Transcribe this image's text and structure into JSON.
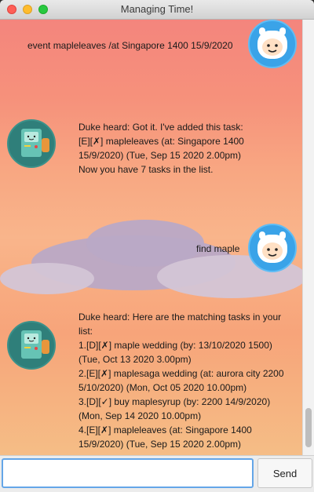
{
  "window": {
    "title": "Managing Time!"
  },
  "messages": [
    {
      "speaker": "user",
      "text": "event mapleleaves /at Singapore 1400 15/9/2020"
    },
    {
      "speaker": "bot",
      "text": "Duke heard: Got it. I've added this task:\n[E][✗] mapleleaves (at: Singapore 1400\n15/9/2020) (Tue, Sep 15 2020 2.00pm)\nNow you have 7 tasks in the list."
    },
    {
      "speaker": "user",
      "text": "find maple"
    },
    {
      "speaker": "bot",
      "text": "Duke heard: Here are the matching tasks in your\nlist:\n1.[D][✗] maple wedding (by: 13/10/2020 1500)\n(Tue, Oct 13 2020 3.00pm)\n2.[E][✗] maplesaga wedding  (at: aurora city 2200\n5/10/2020) (Mon, Oct 05 2020 10.00pm)\n3.[D][✓] buy maplesyrup (by: 2200 14/9/2020)\n(Mon, Sep 14 2020 10.00pm)\n4.[E][✗] mapleleaves (at: Singapore 1400\n15/9/2020) (Tue, Sep 15 2020 2.00pm)"
    }
  ],
  "input": {
    "value": ""
  },
  "send_button": {
    "label": "Send"
  },
  "colors": {
    "bg_top": "#f4857d",
    "bg_mid": "#f9b58b",
    "accent": "#64a6e8"
  }
}
